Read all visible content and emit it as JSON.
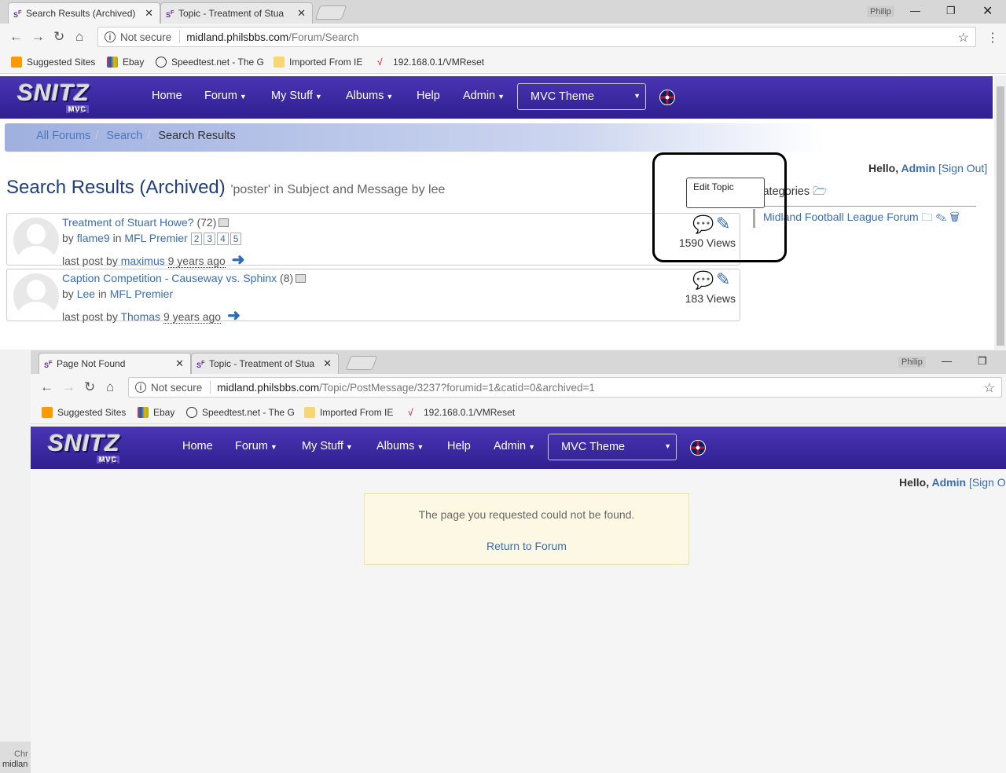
{
  "back_window": {
    "tabs": [
      {
        "label": "Search Results (Archived)"
      },
      {
        "label": "Topic - Treatment of Stua"
      }
    ],
    "user_chip": "Philip",
    "url_not_secure": "Not secure",
    "url_host": "midland.philsbbs.com",
    "url_path": "/Forum/Search",
    "bookmarks": [
      "Suggested Sites",
      "Ebay",
      "Speedtest.net - The G",
      "Imported From IE",
      "192.168.0.1/VMReset"
    ],
    "logo": "SNITZ",
    "logo_sub": "MVC",
    "nav": {
      "home": "Home",
      "forum": "Forum",
      "mystuff": "My Stuff",
      "albums": "Albums",
      "help": "Help",
      "admin": "Admin",
      "theme": "MVC Theme"
    },
    "breadcrumb": {
      "all": "All Forums",
      "search": "Search",
      "current": "Search Results"
    },
    "hello": {
      "prefix": "Hello,",
      "user": "Admin",
      "signout": "[Sign Out]"
    },
    "title": "Search Results (Archived)",
    "subtitle": "'poster' in Subject and Message by lee",
    "results": [
      {
        "topic": "Treatment of Stuart Howe?",
        "count": "(72)",
        "by": "by",
        "author": "flame9",
        "in": "in",
        "forum": "MFL Premier",
        "pages": [
          "2",
          "3",
          "4",
          "5"
        ],
        "lastpost": "last post by",
        "lastuser": "maximus",
        "ago": "9 years ago",
        "views": "1590 Views"
      },
      {
        "topic": "Caption Competition - Causeway vs. Sphinx",
        "count": "(8)",
        "by": "by",
        "author": "Lee",
        "in": "in",
        "forum": "MFL Premier",
        "pages": [],
        "lastpost": "last post by",
        "lastuser": "Thomas",
        "ago": "9 years ago",
        "views": "183 Views"
      }
    ],
    "tooltip": "Edit Topic",
    "categories": "Categories",
    "forum_item": "Midland Football League Forum"
  },
  "front_window": {
    "tabs": [
      {
        "label": "Page Not Found"
      },
      {
        "label": "Topic - Treatment of Stua"
      }
    ],
    "user_chip": "Philip",
    "url_not_secure": "Not secure",
    "url_host": "midland.philsbbs.com",
    "url_path": "/Topic/PostMessage/3237?forumid=1&catid=0&archived=1",
    "bookmarks": [
      "Suggested Sites",
      "Ebay",
      "Speedtest.net - The G",
      "Imported From IE",
      "192.168.0.1/VMReset"
    ],
    "hello": {
      "prefix": "Hello,",
      "user": "Admin",
      "signout": "[Sign O"
    },
    "notfound_msg": "The page you requested could not be found.",
    "return_link": "Return to Forum"
  },
  "status_bar": {
    "line1": "Chr",
    "line2": "midlan"
  },
  "colors": {
    "navbar": "#3a2aa0",
    "link": "#3a6db0",
    "alert_bg": "#fcf8e3"
  }
}
